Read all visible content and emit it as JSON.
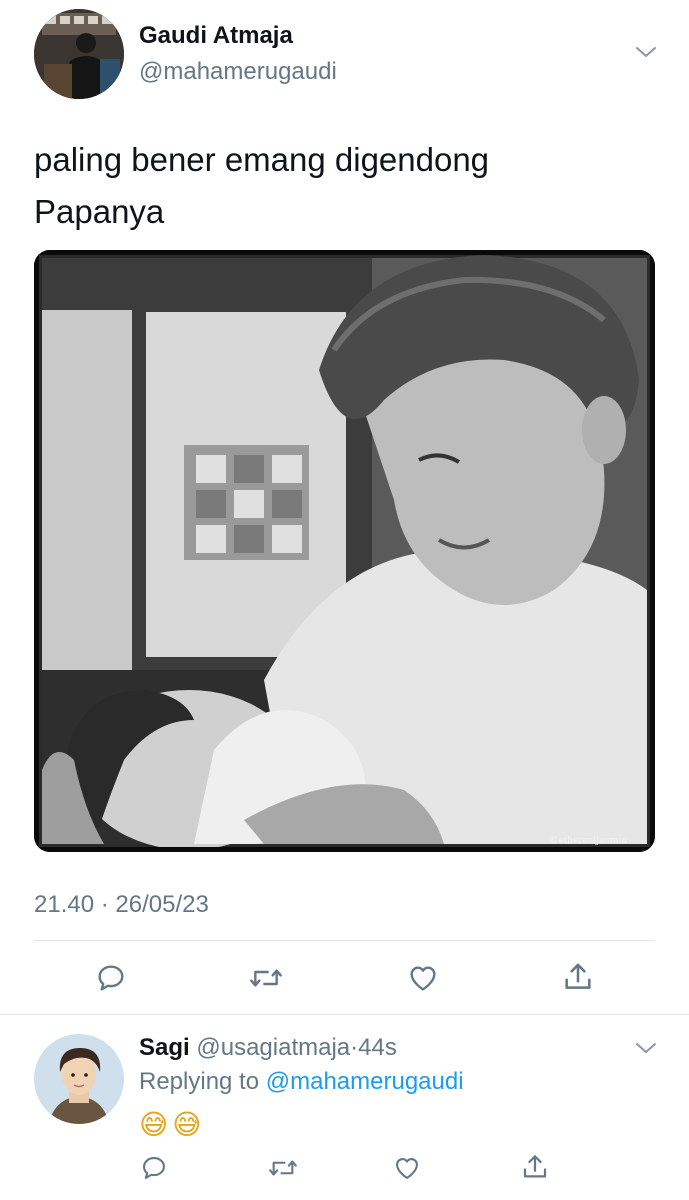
{
  "tweet": {
    "author_name": "Gaudi Atmaja",
    "author_handle": "@mahamerugaudi",
    "text_line1": "paling bener emang digendong",
    "text_line2": "Papanya",
    "photo_watermark": "©etherealjaemin",
    "timestamp": "21.40 · 26/05/23",
    "actions": [
      "reply-icon",
      "retweet-icon",
      "like-icon",
      "share-icon"
    ]
  },
  "reply": {
    "author_name": "Sagi",
    "author_handle": "@usagiatmaja",
    "separator": "·",
    "time_ago": "44s",
    "replying_to_prefix": "Replying to",
    "replying_to_handle": "@mahamerugaudi",
    "emojis": "😅😅",
    "actions": [
      "reply-icon",
      "retweet-icon",
      "like-icon",
      "share-icon"
    ]
  },
  "colors": {
    "text": "#0f1419",
    "muted": "#657786",
    "link": "#1d9bf0",
    "divider": "#e1e8ed"
  }
}
